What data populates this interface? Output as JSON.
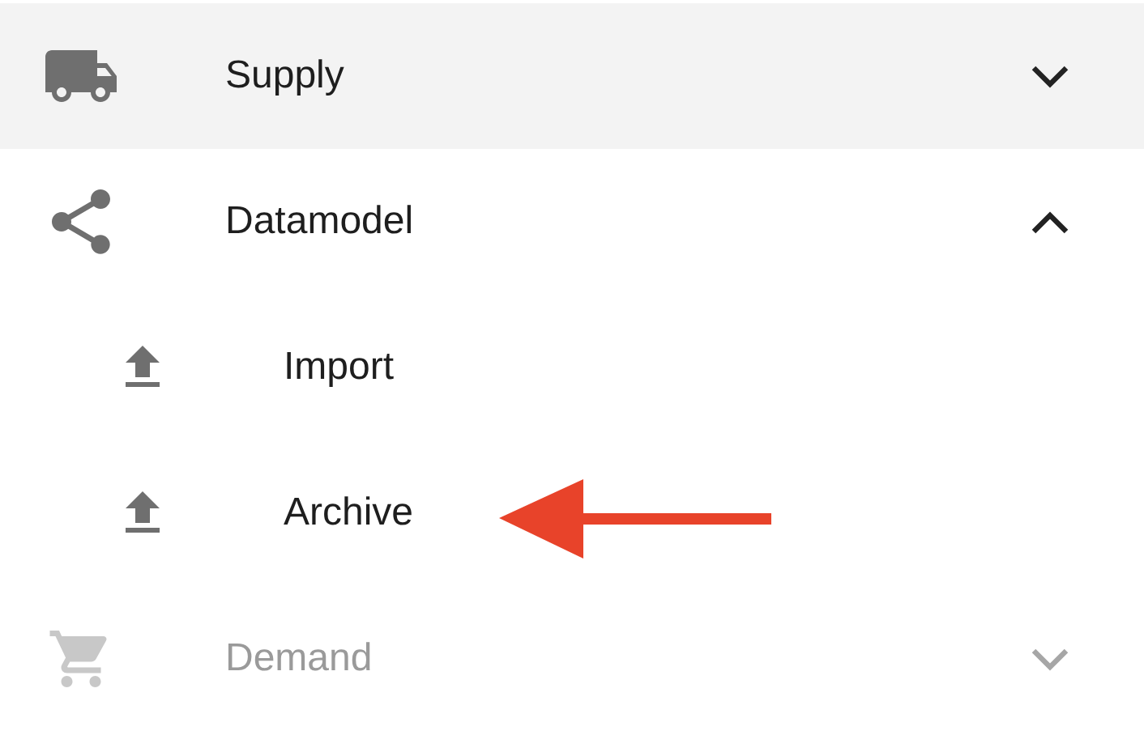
{
  "menu": [
    {
      "label": "Supply",
      "selected": true,
      "expanded": false,
      "disabled": false
    },
    {
      "label": "Datamodel",
      "selected": false,
      "expanded": true,
      "disabled": false,
      "children": [
        {
          "label": "Import",
          "disabled": false
        },
        {
          "label": "Archive",
          "disabled": false
        }
      ]
    },
    {
      "label": "Demand",
      "selected": false,
      "expanded": false,
      "disabled": true
    }
  ]
}
